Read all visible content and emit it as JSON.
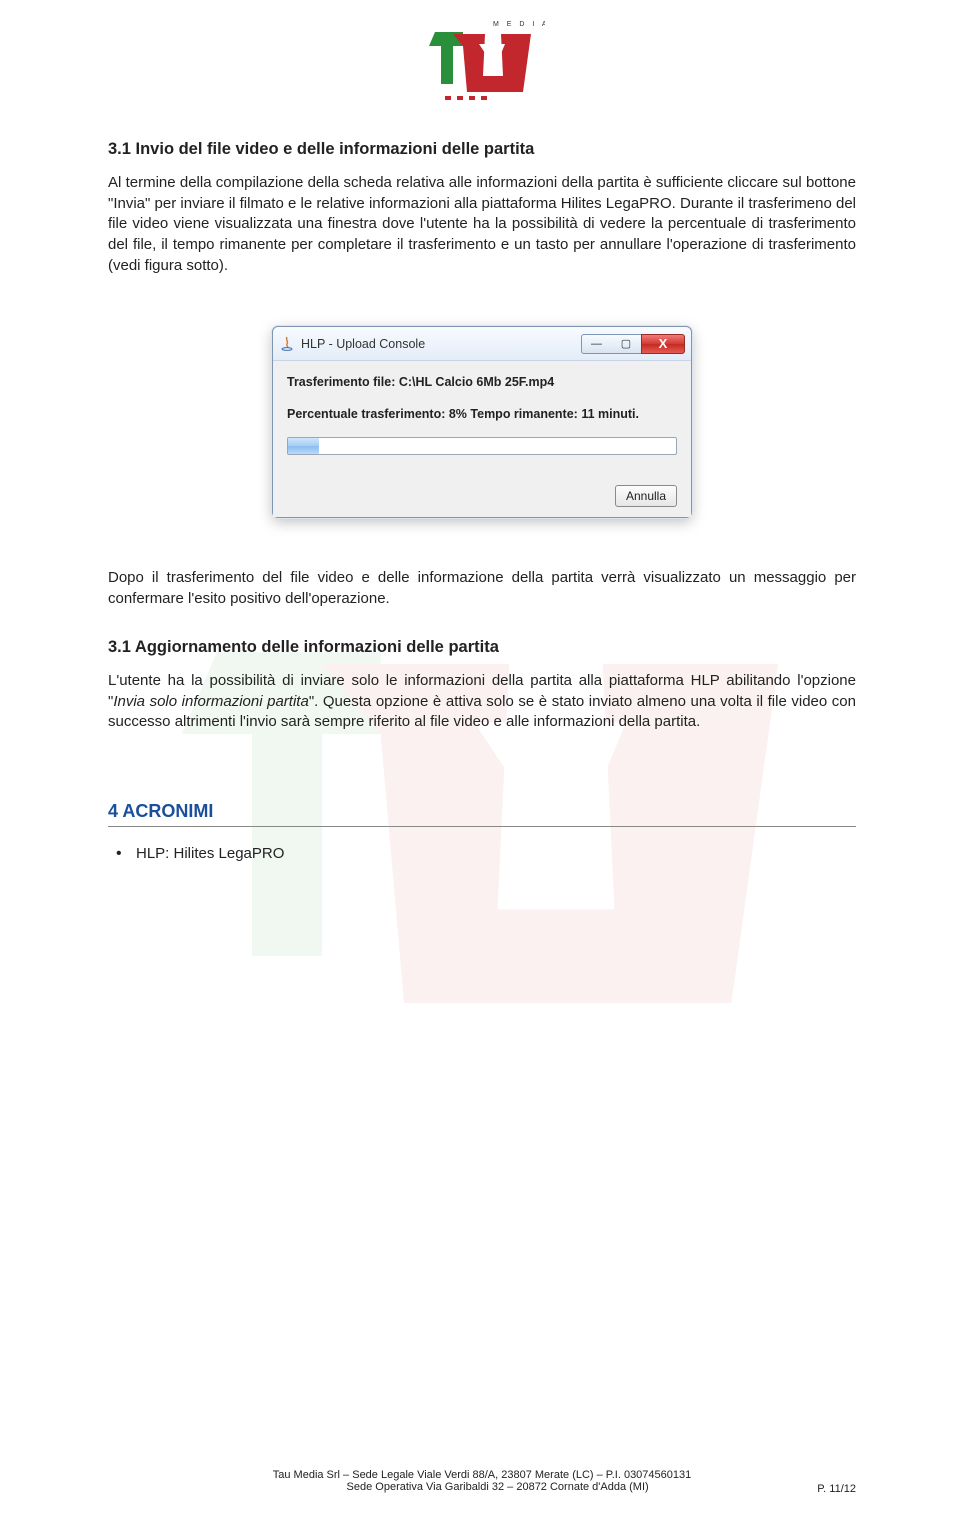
{
  "logo": {
    "media_label": "M E D I A"
  },
  "section_31": {
    "heading": "3.1  Invio del file video e delle informazioni delle partita",
    "para1_a": "Al termine della compilazione della scheda relativa alle informazioni della partita è sufficiente cliccare sul bottone ",
    "para1_quote": "\"Invia\"",
    "para1_b": " per inviare il filmato e le relative informazioni alla piattaforma Hilites LegaPRO. Durante il trasferimeno del file video viene  visualizzata una finestra dove l'utente ha la possibilità di vedere la percentuale di trasferimento del file, il tempo rimanente per completare il trasferimento e un tasto per annullare l'operazione di trasferimento (vedi figura sotto)."
  },
  "upload_dialog": {
    "title": "HLP - Upload Console",
    "line1_label": "Trasferimento file: ",
    "line1_value": "C:\\HL Calcio 6Mb 25F.mp4",
    "line2_pct_label": "Percentuale trasferimento: ",
    "line2_pct_value": "8%",
    "line2_time_label": "   Tempo rimanente: ",
    "line2_time_value": "11 minuti.",
    "cancel_label": "Annulla",
    "progress_percent": 8
  },
  "after_figure_para": "Dopo il trasferimento del file video e delle informazione della partita verrà visualizzato un messaggio per confermare l'esito positivo dell'operazione.",
  "section_31b": {
    "heading": "3.1  Aggiornamento delle informazioni delle partita",
    "para_a": "L'utente ha la possibilità di inviare solo le informazioni della partita alla piattaforma HLP abilitando l'opzione \"",
    "para_quote": "Invia solo informazioni partita",
    "para_b": "\". Questa opzione è attiva solo se è stato inviato almeno una volta il file video con successo altrimenti l'invio sarà sempre riferito al file video e alle informazioni della partita."
  },
  "section_4": {
    "heading": "4   ACRONIMI",
    "item": "HLP: Hilites LegaPRO"
  },
  "footer": {
    "line1": "Tau Media Srl – Sede Legale Viale Verdi 88/A, 23807 Merate (LC) – P.I. 03074560131",
    "line2": "Sede Operativa Via Garibaldi 32 – 20872 Cornate d'Adda (MI)",
    "pnum": "P. 11/12"
  }
}
